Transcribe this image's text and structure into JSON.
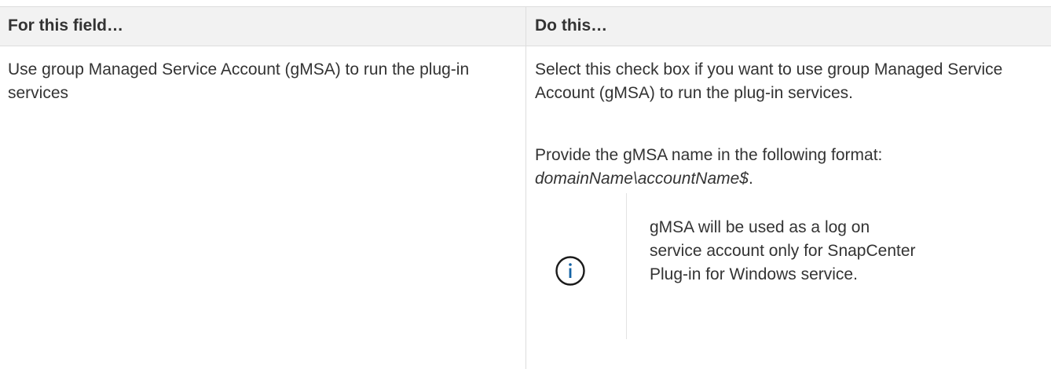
{
  "table": {
    "headers": {
      "field": "For this field…",
      "action": "Do this…"
    },
    "rows": [
      {
        "field": "Use group Managed Service Account (gMSA) to run the plug-in services",
        "action_paragraph_1": "Select this check box if you want to use group Managed Service Account (gMSA) to run the plug-in services.",
        "action_paragraph_2_prefix": "Provide the gMSA name in the following format: ",
        "action_paragraph_2_format": "domainName\\accountName$",
        "action_paragraph_2_suffix": ".",
        "note": {
          "icon": "info-icon",
          "text": "gMSA will be used as a log on service account only for SnapCenter Plug-in for Windows service."
        }
      }
    ]
  },
  "colors": {
    "header_background": "#f2f2f2",
    "border": "#dddddd",
    "text": "#333333",
    "icon_accent": "#1563a5"
  }
}
